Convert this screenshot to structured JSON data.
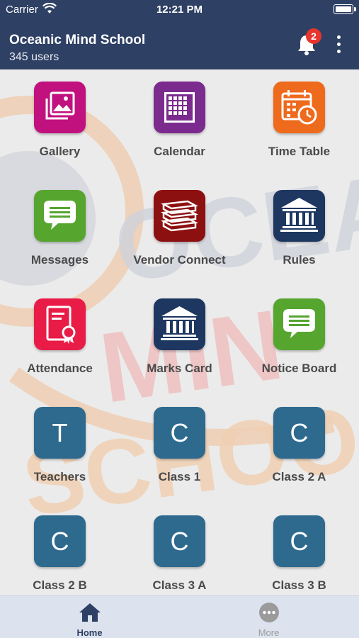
{
  "status_bar": {
    "carrier": "Carrier",
    "time": "12:21 PM"
  },
  "header": {
    "title": "Oceanic Mind School",
    "subtitle": "345 users",
    "notification_count": "2",
    "accent_color": "#2e4064",
    "badge_color": "#e8352d"
  },
  "background_watermark": {
    "logo_text_lines": [
      "OCEA",
      "MIN",
      "SCHOO"
    ]
  },
  "tiles": [
    {
      "label": "Gallery",
      "icon": "gallery-icon",
      "color": "#c0117e"
    },
    {
      "label": "Calendar",
      "icon": "calendar-icon",
      "color": "#7b2b8e"
    },
    {
      "label": "Time Table",
      "icon": "timetable-icon",
      "color": "#ee6a1c"
    },
    {
      "label": "Messages",
      "icon": "messages-icon",
      "color": "#56a52f"
    },
    {
      "label": "Vendor Connect",
      "icon": "books-icon",
      "color": "#8c1010"
    },
    {
      "label": "Rules",
      "icon": "institution-icon",
      "color": "#1d3761"
    },
    {
      "label": "Attendance",
      "icon": "certificate-icon",
      "color": "#e81c47"
    },
    {
      "label": "Marks Card",
      "icon": "institution-icon",
      "color": "#1d3761"
    },
    {
      "label": "Notice Board",
      "icon": "messages-icon",
      "color": "#56a52f"
    },
    {
      "label": "Teachers",
      "letter": "T",
      "color": "#2e6a8e"
    },
    {
      "label": "Class 1",
      "letter": "C",
      "color": "#2e6a8e"
    },
    {
      "label": "Class 2 A",
      "letter": "C",
      "color": "#2e6a8e"
    },
    {
      "label": "Class 2 B",
      "letter": "C",
      "color": "#2e6a8e"
    },
    {
      "label": "Class 3 A",
      "letter": "C",
      "color": "#2e6a8e"
    },
    {
      "label": "Class 3 B",
      "letter": "C",
      "color": "#2e6a8e"
    }
  ],
  "tab_bar": {
    "home": {
      "label": "Home",
      "icon": "home-icon",
      "active": true
    },
    "more": {
      "label": "More",
      "icon": "more-icon",
      "active": false
    }
  }
}
